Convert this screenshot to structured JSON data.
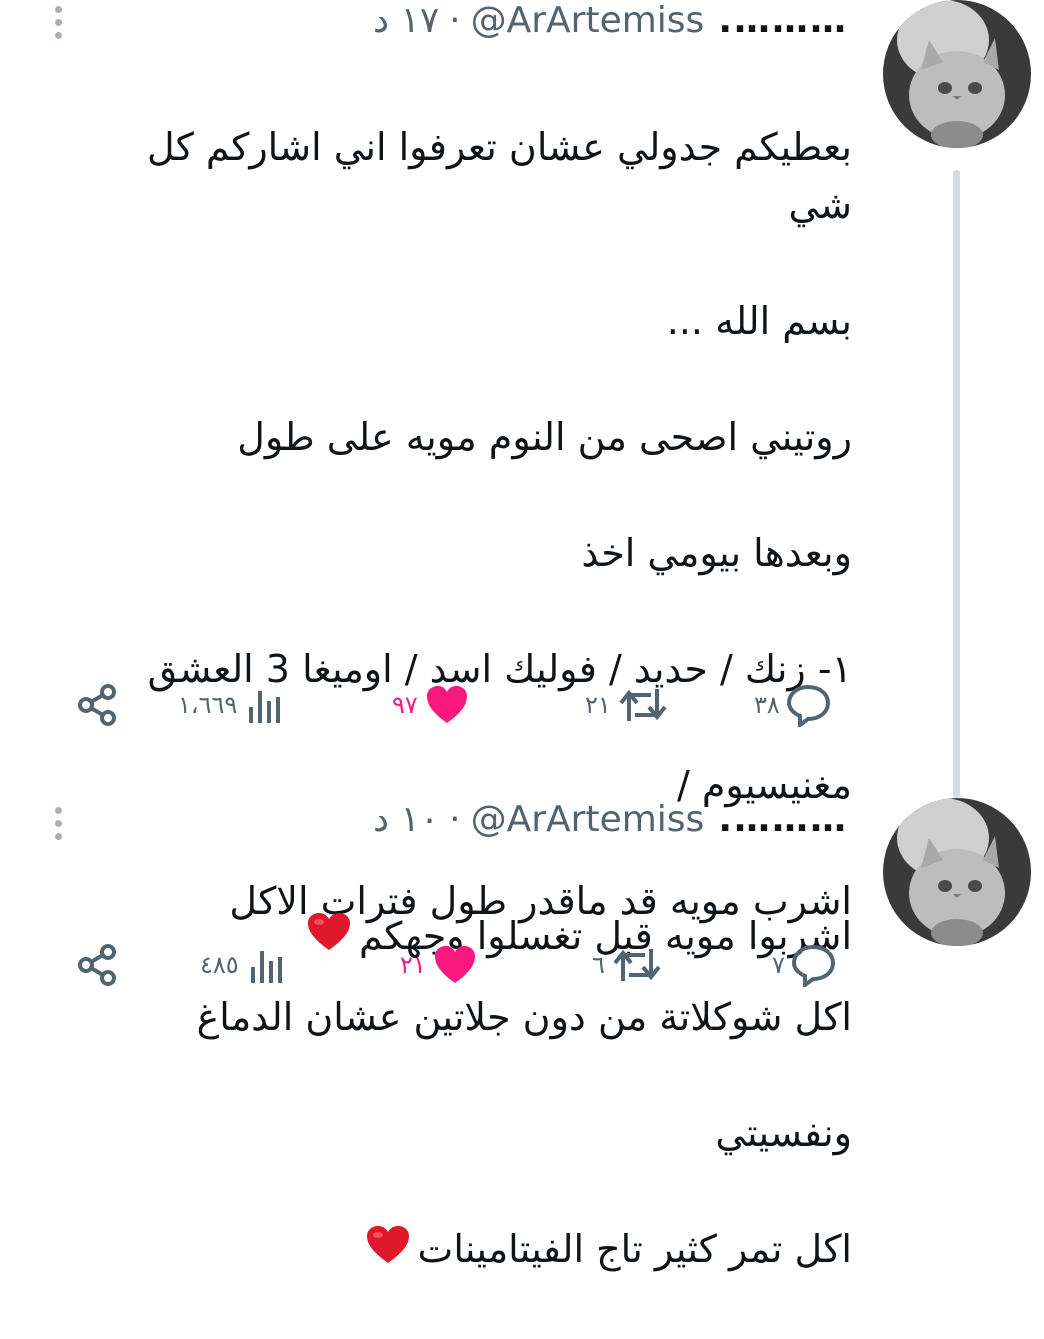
{
  "tweets": [
    {
      "display_name": "……….",
      "handle": "@ArArtemiss",
      "time": "١٧ د",
      "lines": [
        "بعطيكم جدولي عشان تعرفوا اني اشاركم كل شي",
        "بسم الله ...",
        "روتيني اصحى من النوم مويه على طول",
        "وبعدها بيومي اخذ",
        "١- زنك / حديد / فوليك اسد / اوميغا 3 العشق",
        "مغنيسيوم /",
        "اشرب مويه قد ماقدر طول فترات الاكل",
        "اكل شوكلاتة من دون جلاتين عشان الدماغ",
        "ونفسيتي",
        "اكل تمر كثير تاج الفيتامينات"
      ],
      "stats": {
        "replies": "٣٨",
        "retweets": "٢١",
        "likes": "٩٧",
        "views": "١،٦٦٩"
      }
    },
    {
      "display_name": "……….",
      "handle": "@ArArtemiss",
      "time": "١٠ د",
      "lines": [
        "اشربوا مويه قبل تغسلوا وجهكم"
      ],
      "stats": {
        "replies": "٧",
        "retweets": "٦",
        "likes": "٢١",
        "views": "٤٨٥"
      }
    }
  ],
  "emoji": "red-heart",
  "colors": {
    "text": "#0f1419",
    "muted": "#536471",
    "like": "#f91880",
    "heart": "#e0182b",
    "thread": "#d6dbdf"
  }
}
